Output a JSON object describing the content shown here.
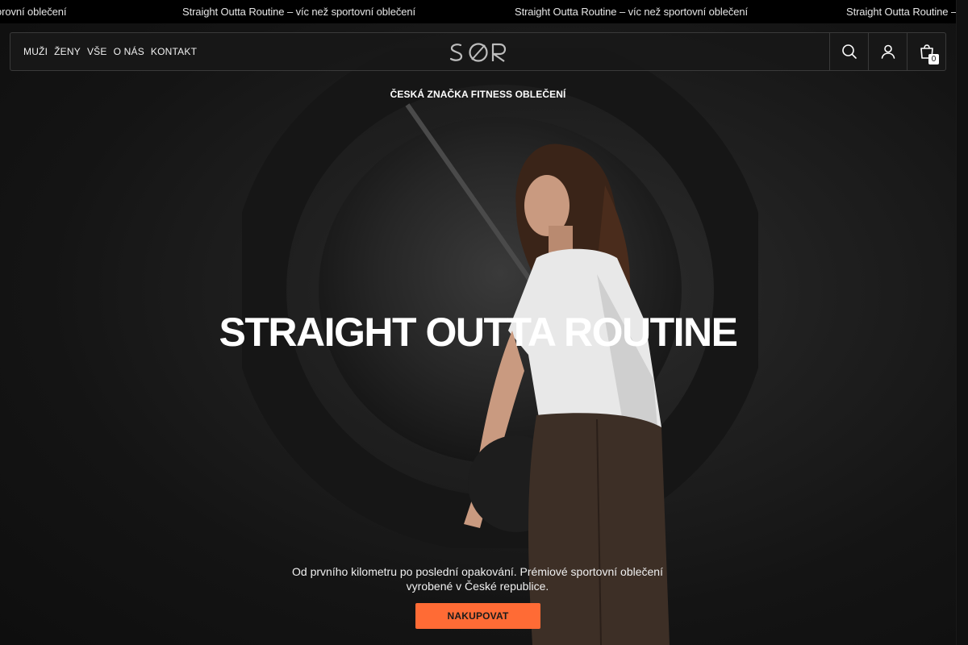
{
  "announcement": {
    "items": [
      "orovní oblečení",
      "Straight Outta Routine – víc než sportovní oblečení",
      "Straight Outta Routine – víc než sportovní oblečení",
      "Straight Outta Routine – víc než"
    ]
  },
  "header": {
    "nav": [
      {
        "label": "MUŽI",
        "icon": null
      },
      {
        "label": "ŽENY",
        "icon": null
      },
      {
        "label": "VŠE",
        "icon": null
      },
      {
        "label": "O NÁS",
        "icon": null
      },
      {
        "label": "KONTAKT",
        "icon": null
      }
    ],
    "logo_icon": "sor-logo",
    "icons": [
      "search-icon",
      "account-icon",
      "cart-icon"
    ],
    "cart_count": "0"
  },
  "hero": {
    "subtitle": "ČESKÁ ZNAČKA FITNESS OBLEČENÍ",
    "headline": "STRAIGHT OUTTA ROUTINE",
    "description": "Od prvního kilometru po poslední opakování. Prémiové sportovní oblečení vyrobené v České republice.",
    "cta_label": "NAKUPOVAT",
    "image_icon": "hero-model-image"
  },
  "colors": {
    "accent": "#ff6b35",
    "background": "#141414",
    "header_bg": "#181818"
  }
}
